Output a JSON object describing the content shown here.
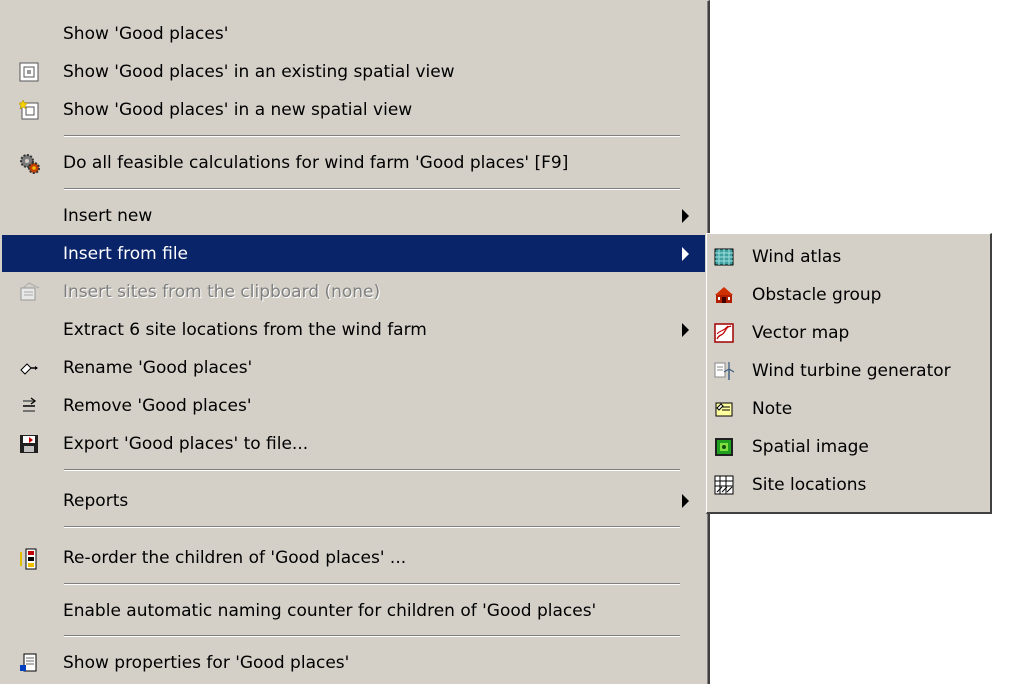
{
  "main_menu": {
    "items": [
      {
        "label": "Show 'Good places'",
        "icon": "none"
      },
      {
        "label": "Show 'Good places' in an existing spatial view",
        "icon": "spatial-view-icon"
      },
      {
        "label": "Show 'Good places' in a new spatial view",
        "icon": "new-spatial-view-icon"
      },
      {
        "label": "Do all feasible calculations for wind farm 'Good places' [F9]",
        "icon": "gears-icon"
      },
      {
        "label": "Insert new",
        "icon": "none",
        "submenu": true
      },
      {
        "label": "Insert from file",
        "icon": "none",
        "submenu": true,
        "highlighted": true
      },
      {
        "label": "Insert sites from the clipboard (none)",
        "icon": "clipboard-icon",
        "disabled": true
      },
      {
        "label": "Extract 6 site locations from the wind farm",
        "icon": "none",
        "submenu": true
      },
      {
        "label": "Rename 'Good places'",
        "icon": "rename-icon"
      },
      {
        "label": "Remove 'Good places'",
        "icon": "remove-icon"
      },
      {
        "label": "Export 'Good places' to file...",
        "icon": "export-disk-icon"
      },
      {
        "label": "Reports",
        "icon": "none",
        "submenu": true
      },
      {
        "label": "Re-order the children of 'Good places' ...",
        "icon": "reorder-icon"
      },
      {
        "label": "Enable automatic naming counter for children of 'Good places'",
        "icon": "none"
      },
      {
        "label": "Show properties for 'Good places'",
        "icon": "properties-icon"
      }
    ]
  },
  "sub_menu": {
    "items": [
      {
        "label": "Wind atlas",
        "icon": "wind-atlas-icon"
      },
      {
        "label": "Obstacle group",
        "icon": "obstacle-group-icon"
      },
      {
        "label": "Vector map",
        "icon": "vector-map-icon"
      },
      {
        "label": "Wind turbine generator",
        "icon": "wind-turbine-icon"
      },
      {
        "label": "Note",
        "icon": "note-icon"
      },
      {
        "label": "Spatial image",
        "icon": "spatial-image-icon"
      },
      {
        "label": "Site locations",
        "icon": "site-locations-icon"
      }
    ]
  },
  "colors": {
    "menu_bg": "#d4d0c8",
    "highlight_bg": "#0a246a",
    "highlight_text": "#ffffff",
    "disabled_text": "#808080"
  }
}
